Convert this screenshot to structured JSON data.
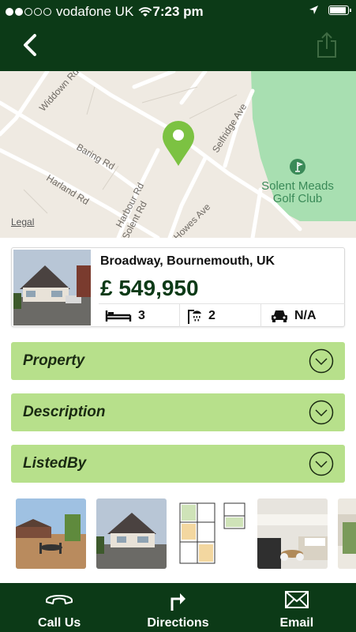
{
  "status_bar": {
    "carrier": "vodafone UK",
    "time": "7:23 pm",
    "signal_bars_filled": 2,
    "signal_bars_total": 5,
    "battery_level": 0.9
  },
  "header": {
    "back_icon": "chevron-left-icon",
    "share_icon": "share-icon",
    "bg_color": "#0c3a17"
  },
  "map": {
    "streets": [
      "Widdown Rd",
      "Baring Rd",
      "Harland Rd",
      "Harbour Rd",
      "Solent Rd",
      "Selfridge Ave",
      "Howes Ave"
    ],
    "poi": [
      "Solent Meads",
      "Golf Club"
    ],
    "legal": "Legal",
    "pin_color": "#7cc242",
    "park_color": "#a8dfb1"
  },
  "summary": {
    "address": "Broadway, Bournemouth, UK",
    "price": "£ 549,950",
    "bedrooms": "3",
    "bathrooms": "2",
    "parking": "N/A"
  },
  "sections": [
    {
      "title": "Property"
    },
    {
      "title": "Description"
    },
    {
      "title": "ListedBy"
    }
  ],
  "section_color": "#b7e08b",
  "bottom_bar": [
    {
      "label": "Call Us",
      "icon": "phone-icon"
    },
    {
      "label": "Directions",
      "icon": "turn-right-arrow-icon"
    },
    {
      "label": "Email",
      "icon": "envelope-icon"
    }
  ]
}
